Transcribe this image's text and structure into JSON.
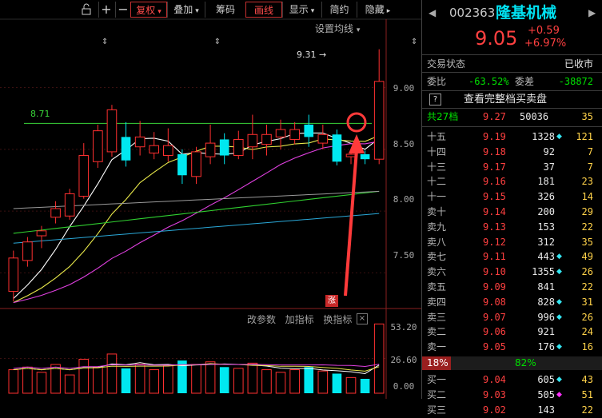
{
  "toolbar": {
    "buttons": [
      {
        "label": "复权",
        "arrow": "▾",
        "highlight": true
      },
      {
        "label": "叠加",
        "arrow": "▾",
        "highlight": false
      },
      {
        "label": "筹码",
        "arrow": "",
        "highlight": false
      },
      {
        "label": "画线",
        "arrow": "",
        "highlight": true
      },
      {
        "label": "显示",
        "arrow": "▾",
        "highlight": false
      },
      {
        "label": "简约",
        "arrow": "",
        "highlight": false
      },
      {
        "label": "隐藏",
        "arrow": "▸",
        "highlight": false
      }
    ],
    "icons": [
      "lock-icon",
      "plus-icon",
      "minus-icon"
    ]
  },
  "chart": {
    "ma_settings": "设置均线",
    "high_label": "9.31",
    "line_label": "8.71",
    "y_ticks": [
      "9.00",
      "8.50",
      "8.00",
      "7.50"
    ],
    "zhang_badge": "涨",
    "vol_menu": [
      "改参数",
      "加指标",
      "换指标"
    ],
    "vol_ticks": [
      "53.20",
      "26.60",
      "0.00"
    ]
  },
  "chart_data": {
    "type": "candlestick",
    "ylim": [
      7.25,
      9.45
    ],
    "horizontal_line": 8.71,
    "candles": [
      {
        "o": 7.35,
        "c": 7.62,
        "h": 7.68,
        "l": 7.27,
        "up": true
      },
      {
        "o": 7.6,
        "c": 7.75,
        "h": 7.79,
        "l": 7.55,
        "up": true
      },
      {
        "o": 7.8,
        "c": 7.84,
        "h": 7.88,
        "l": 7.7,
        "up": true
      },
      {
        "o": 7.95,
        "c": 8.02,
        "h": 8.08,
        "l": 7.9,
        "up": true
      },
      {
        "o": 7.96,
        "c": 8.14,
        "h": 8.18,
        "l": 7.93,
        "up": true
      },
      {
        "o": 8.12,
        "c": 8.45,
        "h": 8.55,
        "l": 8.1,
        "up": true
      },
      {
        "o": 8.4,
        "c": 8.65,
        "h": 8.7,
        "l": 8.35,
        "up": true
      },
      {
        "o": 8.48,
        "c": 8.82,
        "h": 8.86,
        "l": 8.44,
        "up": true
      },
      {
        "o": 8.6,
        "c": 8.41,
        "h": 8.72,
        "l": 8.36,
        "up": false
      },
      {
        "o": 8.52,
        "c": 8.6,
        "h": 8.73,
        "l": 8.45,
        "up": true
      },
      {
        "o": 8.53,
        "c": 8.47,
        "h": 8.64,
        "l": 8.42,
        "up": true
      },
      {
        "o": 8.45,
        "c": 8.53,
        "h": 8.67,
        "l": 8.4,
        "up": true
      },
      {
        "o": 8.46,
        "c": 8.29,
        "h": 8.5,
        "l": 8.22,
        "up": false
      },
      {
        "o": 8.28,
        "c": 8.48,
        "h": 8.52,
        "l": 8.22,
        "up": true
      },
      {
        "o": 8.44,
        "c": 8.55,
        "h": 8.7,
        "l": 8.38,
        "up": true
      },
      {
        "o": 8.58,
        "c": 8.45,
        "h": 8.63,
        "l": 8.38,
        "up": false
      },
      {
        "o": 8.45,
        "c": 8.58,
        "h": 8.65,
        "l": 8.42,
        "up": true
      },
      {
        "o": 8.52,
        "c": 8.62,
        "h": 8.78,
        "l": 8.42,
        "up": true
      },
      {
        "o": 8.54,
        "c": 8.62,
        "h": 8.7,
        "l": 8.45,
        "up": true
      },
      {
        "o": 8.6,
        "c": 8.66,
        "h": 8.74,
        "l": 8.5,
        "up": true
      },
      {
        "o": 8.58,
        "c": 8.66,
        "h": 8.72,
        "l": 8.54,
        "up": true
      },
      {
        "o": 8.7,
        "c": 8.6,
        "h": 8.78,
        "l": 8.52,
        "up": false
      },
      {
        "o": 8.55,
        "c": 8.62,
        "h": 8.7,
        "l": 8.5,
        "up": true
      },
      {
        "o": 8.62,
        "c": 8.4,
        "h": 8.66,
        "l": 8.37,
        "up": false
      },
      {
        "o": 8.44,
        "c": 8.46,
        "h": 8.5,
        "l": 8.38,
        "up": true
      },
      {
        "o": 8.46,
        "c": 8.42,
        "h": 8.49,
        "l": 8.38,
        "up": false
      },
      {
        "o": 8.42,
        "c": 9.05,
        "h": 9.31,
        "l": 8.38,
        "up": true
      }
    ],
    "volumes": [
      18,
      20,
      16,
      22,
      14,
      26,
      20,
      30,
      19,
      22,
      18,
      21,
      25,
      22,
      24,
      20,
      19,
      23,
      18,
      16,
      18,
      20,
      17,
      15,
      12,
      11,
      53
    ],
    "volume_ylim": [
      0,
      53.2
    ]
  },
  "quote": {
    "code": "002363",
    "name": "隆基机械",
    "price": "9.05",
    "change": "+0.59",
    "change_pct": "+6.97%",
    "status_label": "交易状态",
    "status_value": "已收市",
    "ratio_label": "委比",
    "ratio_value": "-63.52%",
    "diff_label": "委差",
    "diff_value": "-38872",
    "help_icon": "?",
    "full_book": "查看完整档买卖盘",
    "total_label": "共27档",
    "total_price": "9.27",
    "total_vol": "50036",
    "total_count": "35"
  },
  "asks": [
    {
      "label": "十五",
      "price": "9.19",
      "vol": "1328",
      "mark": "◆",
      "cnt": "121"
    },
    {
      "label": "十四",
      "price": "9.18",
      "vol": "92",
      "mark": "",
      "cnt": "7"
    },
    {
      "label": "十三",
      "price": "9.17",
      "vol": "37",
      "mark": "",
      "cnt": "7"
    },
    {
      "label": "十二",
      "price": "9.16",
      "vol": "181",
      "mark": "",
      "cnt": "23"
    },
    {
      "label": "十一",
      "price": "9.15",
      "vol": "326",
      "mark": "",
      "cnt": "14"
    },
    {
      "label": "卖十",
      "price": "9.14",
      "vol": "200",
      "mark": "",
      "cnt": "29"
    },
    {
      "label": "卖九",
      "price": "9.13",
      "vol": "153",
      "mark": "",
      "cnt": "22"
    },
    {
      "label": "卖八",
      "price": "9.12",
      "vol": "312",
      "mark": "",
      "cnt": "35"
    },
    {
      "label": "卖七",
      "price": "9.11",
      "vol": "443",
      "mark": "◆",
      "cnt": "49"
    },
    {
      "label": "卖六",
      "price": "9.10",
      "vol": "1355",
      "mark": "◆",
      "cnt": "26"
    },
    {
      "label": "卖五",
      "price": "9.09",
      "vol": "841",
      "mark": "",
      "cnt": "22"
    },
    {
      "label": "卖四",
      "price": "9.08",
      "vol": "828",
      "mark": "◆",
      "cnt": "31"
    },
    {
      "label": "卖三",
      "price": "9.07",
      "vol": "996",
      "mark": "◆",
      "cnt": "26"
    },
    {
      "label": "卖二",
      "price": "9.06",
      "vol": "921",
      "mark": "",
      "cnt": "24"
    },
    {
      "label": "卖一",
      "price": "9.05",
      "vol": "176",
      "mark": "◆",
      "cnt": "16"
    }
  ],
  "balance": {
    "left": "18%",
    "right": "82%"
  },
  "bids": [
    {
      "label": "买一",
      "price": "9.04",
      "vol": "605",
      "mark": "◆",
      "cnt": "43"
    },
    {
      "label": "买二",
      "price": "9.03",
      "vol": "505",
      "mark": "◆",
      "cnt": "51"
    },
    {
      "label": "买三",
      "price": "9.02",
      "vol": "143",
      "mark": "",
      "cnt": "22"
    }
  ],
  "colors": {
    "up": "#ff3030",
    "down": "#00e8f0",
    "ma5": "#ffffff",
    "ma10": "#e8e84a",
    "ma20": "#e040e0",
    "ma30": "#30d030",
    "ma60": "#9a9a9a",
    "ma120": "#2aa8d8",
    "hline": "#39d639",
    "accent": "#ff3a3a"
  }
}
